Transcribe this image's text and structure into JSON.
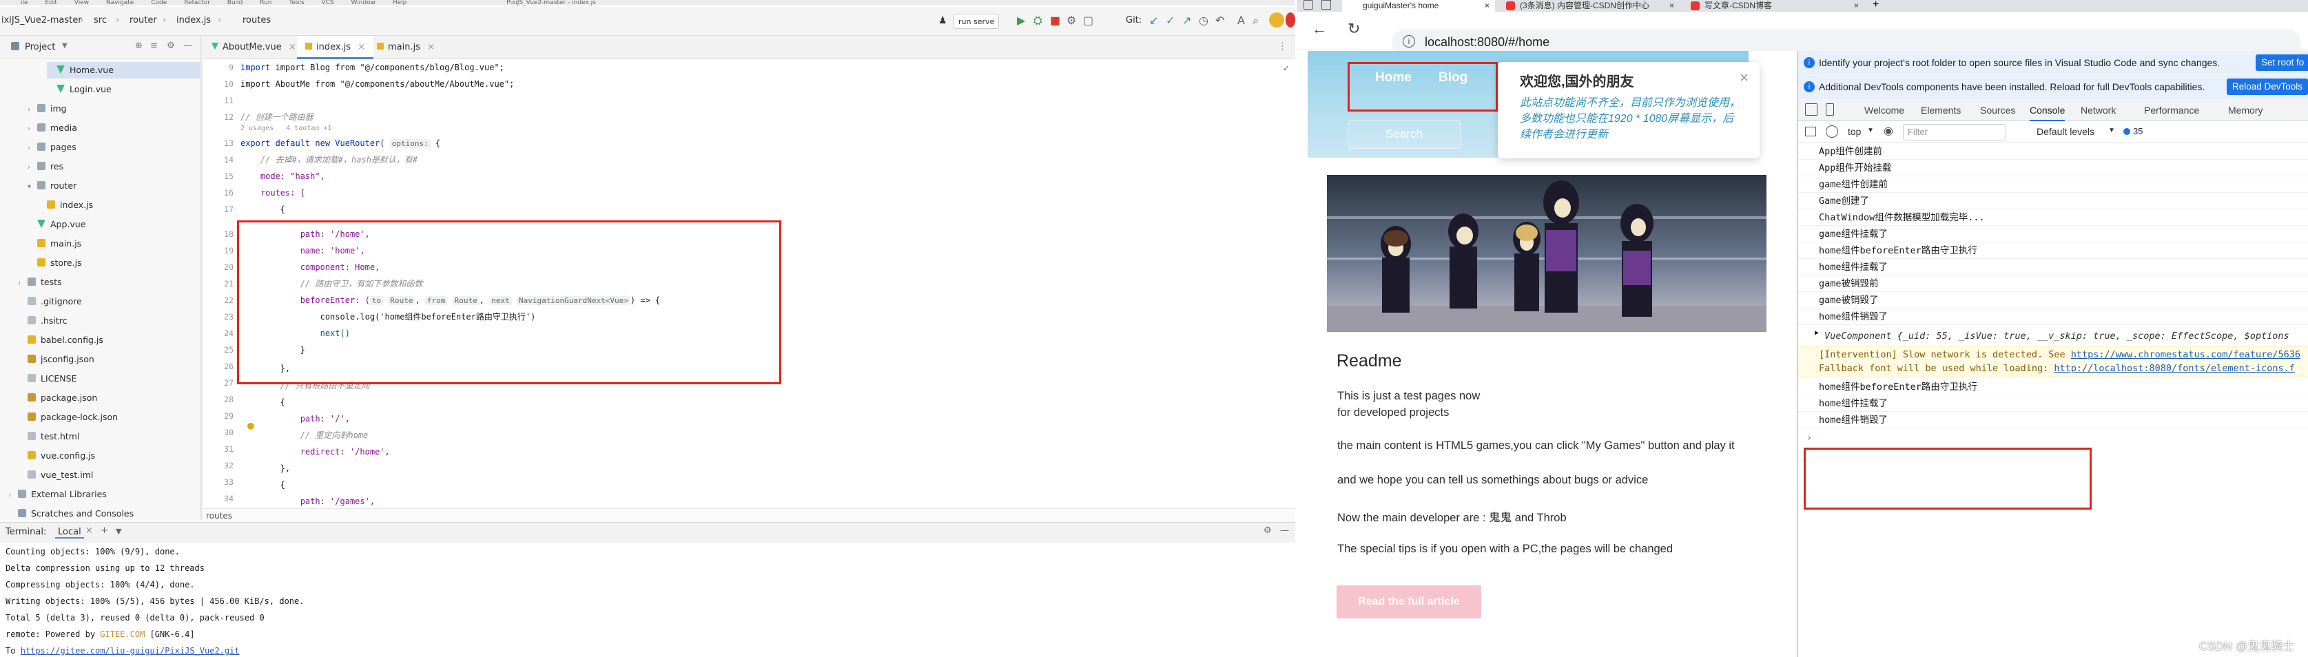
{
  "ide": {
    "menubar": [
      "ile",
      "Edit",
      "View",
      "Navigate",
      "Code",
      "Refactor",
      "Build",
      "Run",
      "Tools",
      "VCS",
      "Window",
      "Help",
      "PixiJS_Vue2-master - index.js"
    ],
    "toolbar": {
      "crumbs": [
        "ixiJS_Vue2-master",
        "src",
        "router",
        "index.js",
        "routes"
      ],
      "run_config": "run serve",
      "git_label": "Git:"
    },
    "project": {
      "label": "Project",
      "items": [
        {
          "label": "Home.vue",
          "indent": 4,
          "icon": "vue",
          "arrow": ""
        },
        {
          "label": "Login.vue",
          "indent": 4,
          "icon": "vue",
          "arrow": ""
        },
        {
          "label": "img",
          "indent": 2,
          "icon": "folder",
          "arrow": ">"
        },
        {
          "label": "media",
          "indent": 2,
          "icon": "folder",
          "arrow": ">"
        },
        {
          "label": "pages",
          "indent": 2,
          "icon": "folder",
          "arrow": ">"
        },
        {
          "label": "res",
          "indent": 2,
          "icon": "folder",
          "arrow": ">"
        },
        {
          "label": "router",
          "indent": 2,
          "icon": "folder",
          "arrow": "v"
        },
        {
          "label": "index.js",
          "indent": 3,
          "icon": "js",
          "arrow": ""
        },
        {
          "label": "App.vue",
          "indent": 2,
          "icon": "vue",
          "arrow": ""
        },
        {
          "label": "main.js",
          "indent": 2,
          "icon": "js",
          "arrow": ""
        },
        {
          "label": "store.js",
          "indent": 2,
          "icon": "js",
          "arrow": ""
        },
        {
          "label": "tests",
          "indent": 1,
          "icon": "folder",
          "arrow": ">"
        },
        {
          "label": ".gitignore",
          "indent": 1,
          "icon": "file",
          "arrow": ""
        },
        {
          "label": ".hsitrc",
          "indent": 1,
          "icon": "file",
          "arrow": ""
        },
        {
          "label": "babel.config.js",
          "indent": 1,
          "icon": "js",
          "arrow": ""
        },
        {
          "label": "jsconfig.json",
          "indent": 1,
          "icon": "json",
          "arrow": ""
        },
        {
          "label": "LICENSE",
          "indent": 1,
          "icon": "file",
          "arrow": ""
        },
        {
          "label": "package.json",
          "indent": 1,
          "icon": "json",
          "arrow": ""
        },
        {
          "label": "package-lock.json",
          "indent": 1,
          "icon": "json",
          "arrow": ""
        },
        {
          "label": "test.html",
          "indent": 1,
          "icon": "file",
          "arrow": ""
        },
        {
          "label": "vue.config.js",
          "indent": 1,
          "icon": "js",
          "arrow": ""
        },
        {
          "label": "vue_test.iml",
          "indent": 1,
          "icon": "file",
          "arrow": ""
        },
        {
          "label": "External Libraries",
          "indent": 0,
          "icon": "folder",
          "arrow": ">"
        },
        {
          "label": "Scratches and Consoles",
          "indent": 0,
          "icon": "txt",
          "arrow": ""
        }
      ]
    },
    "tabs": [
      "AboutMe.vue",
      "index.js",
      "main.js"
    ],
    "line_numbers": [
      "9",
      "10",
      "11",
      "12",
      "13",
      "14",
      "15",
      "16",
      "17",
      "18",
      "19",
      "20",
      "21",
      "22",
      "23",
      "24",
      "25",
      "26",
      "27",
      "28",
      "29",
      "30",
      "31",
      "32",
      "33",
      "34"
    ],
    "code": {
      "l9": "import Blog from \"@/components/blog/Blog.vue\";",
      "l10": "import AboutMe from \"@/components/aboutMe/AboutMe.vue\";",
      "l12": "// 创建一个路由器",
      "l12b": "2 usages   4 taotao +1",
      "l13a": "export default new VueRouter( ",
      "l13h": "options:",
      "l13b": " {",
      "l14": "    // 去掉#，请求加载#，hash是默认，有#",
      "l15": "    mode: \"hash\",",
      "l16": "    routes: [",
      "l17": "        {",
      "l18": "            path: '/home',",
      "l19": "            name: 'home',",
      "l20": "            component: Home,",
      "l21": "            // 路由守卫，有如下参数和函数",
      "l22a": "            beforeEnter: (",
      "l22b": " => {",
      "l23": "                console.log('home组件beforeEnter路由守卫执行')",
      "l24": "                next()",
      "l25": "            }",
      "l26": "        },",
      "l27": "        // 只有根路由不重定向",
      "l28": "        {",
      "l29": "            path: '/',",
      "l30": "            // 重定向到home",
      "l31": "            redirect: '/home',",
      "l32": "        },",
      "l33": "        {",
      "l34": "            path: '/games',"
    },
    "hint_to": "to",
    "hint_route1": "Route",
    "hint_from": "from",
    "hint_route2": "Route",
    "hint_next": "next",
    "hint_guard": "NavigationGuardNext<Vue>",
    "code_breadcrumb": "routes",
    "terminal": {
      "title": "Terminal:",
      "tab": "Local",
      "lines": [
        "Counting objects: 100% (9/9), done.",
        "Delta compression using up to 12 threads",
        "Compressing objects: 100% (4/4), done.",
        "Writing objects: 100% (5/5), 456 bytes | 456.00 KiB/s, done.",
        "Total 5 (delta 3), reused 0 (delta 0), pack-reused 0"
      ],
      "remote_prefix": "remote: Powered by ",
      "remote_gitee": "GITEE.COM",
      "remote_suffix": " [GNK-6.4]",
      "to_prefix": "To ",
      "to_url": "https://gitee.com/liu-guigui/PixiJS_Vue2.git"
    }
  },
  "browser": {
    "tabs": [
      "guiguiMaster's home",
      "(3条消息) 内容管理-CSDN创作中心",
      "写文章-CSDN博客"
    ],
    "url": "localhost:8080/#/home",
    "page": {
      "nav": [
        "Home",
        "Blog"
      ],
      "search": "Search",
      "notice_title": "欢迎您,国外的朋友",
      "notice_body": "此站点功能尚不齐全，目前只作为浏览使用，多数功能也只能在1920 * 1080屏幕显示，后续作者会进行更新",
      "readme": "Readme",
      "p1a": "This is just a test pages now",
      "p1b": "for developed projects",
      "p2": "the main content is HTML5 games,you can click \"My Games\" button and play it",
      "p3": "and we hope you can tell us somethings about bugs or advice",
      "p4": "Now the main developer are : 鬼鬼 and Throb",
      "p5": "The special tips is if you open with a PC,the pages will be changed",
      "read_btn": "Read the full article"
    },
    "devtools": {
      "info1": "Identify your project's root folder to open source files in Visual Studio Code and sync changes.",
      "info1_btn": "Set root fo",
      "info2": "Additional DevTools components have been installed. Reload for full DevTools capabilities.",
      "info2_btn": "Reload DevTools",
      "tabs": [
        "Welcome",
        "Elements",
        "Sources",
        "Console",
        "Network",
        "Performance",
        "Memory"
      ],
      "context": "top",
      "filter_placeholder": "Filter",
      "levels": "Default levels",
      "issues": "35",
      "logs": [
        "App组件创建前",
        "App组件开始挂载",
        "game组件创建前",
        "Game创建了",
        "ChatWindow组件数据模型加载完毕...",
        "game组件挂载了",
        "home组件beforeEnter路由守卫执行",
        "home组件挂载了",
        "game被销毁前",
        "game被销毁了",
        "home组件销毁了"
      ],
      "vuecomponent": "VueComponent {_uid: 55, _isVue: true, __v_skip: true, _scope: EffectScope, $options",
      "warn1a": "[Intervention] Slow network is detected. See ",
      "warn1link": "https://www.chromestatus.com/feature/5636",
      "warn2a": "Fallback font will be used while loading: ",
      "warn2link": "http://localhost:8080/fonts/element-icons.f",
      "logs2": [
        "home组件beforeEnter路由守卫执行",
        "home组件挂载了",
        "home组件销毁了"
      ]
    }
  },
  "watermark": "CSDN @鬼鬼骑士"
}
